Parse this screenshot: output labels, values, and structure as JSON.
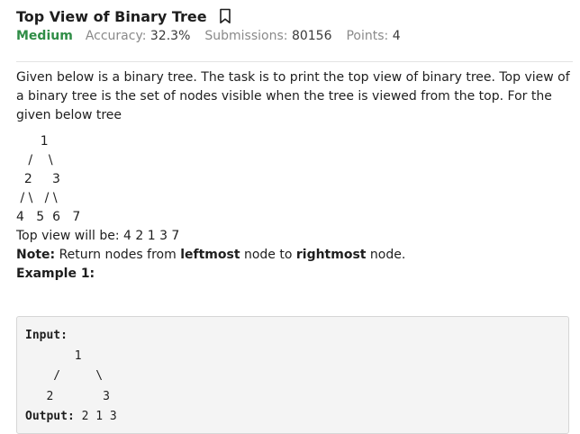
{
  "problem": {
    "title": "Top View of Binary Tree",
    "difficulty": "Medium",
    "accuracy_label": "Accuracy:",
    "accuracy_value": "32.3%",
    "submissions_label": "Submissions:",
    "submissions_value": "80156",
    "points_label": "Points:",
    "points_value": "4",
    "icons": {
      "bookmark": "bookmark-icon"
    },
    "colors": {
      "difficulty": "#2f8d46"
    }
  },
  "statement": {
    "intro": "Given below is a binary tree. The task is to print the top view of binary tree. Top view of a binary tree is the set of nodes visible when the tree is viewed from the top. For the given below tree",
    "tree_lines": [
      "      1",
      "   /    \\",
      "  2     3",
      " / \\   / \\",
      "4   5  6   7"
    ],
    "top_view": "Top view will be: 4 2 1 3 7",
    "note_label": "Note:",
    "note_text_1": " Return nodes from ",
    "note_bold_1": "leftmost",
    "note_text_2": " node to ",
    "note_bold_2": "rightmost",
    "note_text_3": " node."
  },
  "example": {
    "heading": "Example 1:",
    "input_label": "Input:",
    "input_tree_lines": [
      "       1",
      "    /     \\",
      "   2       3"
    ],
    "output_label": "Output:",
    "output_value": "2 1 3"
  }
}
